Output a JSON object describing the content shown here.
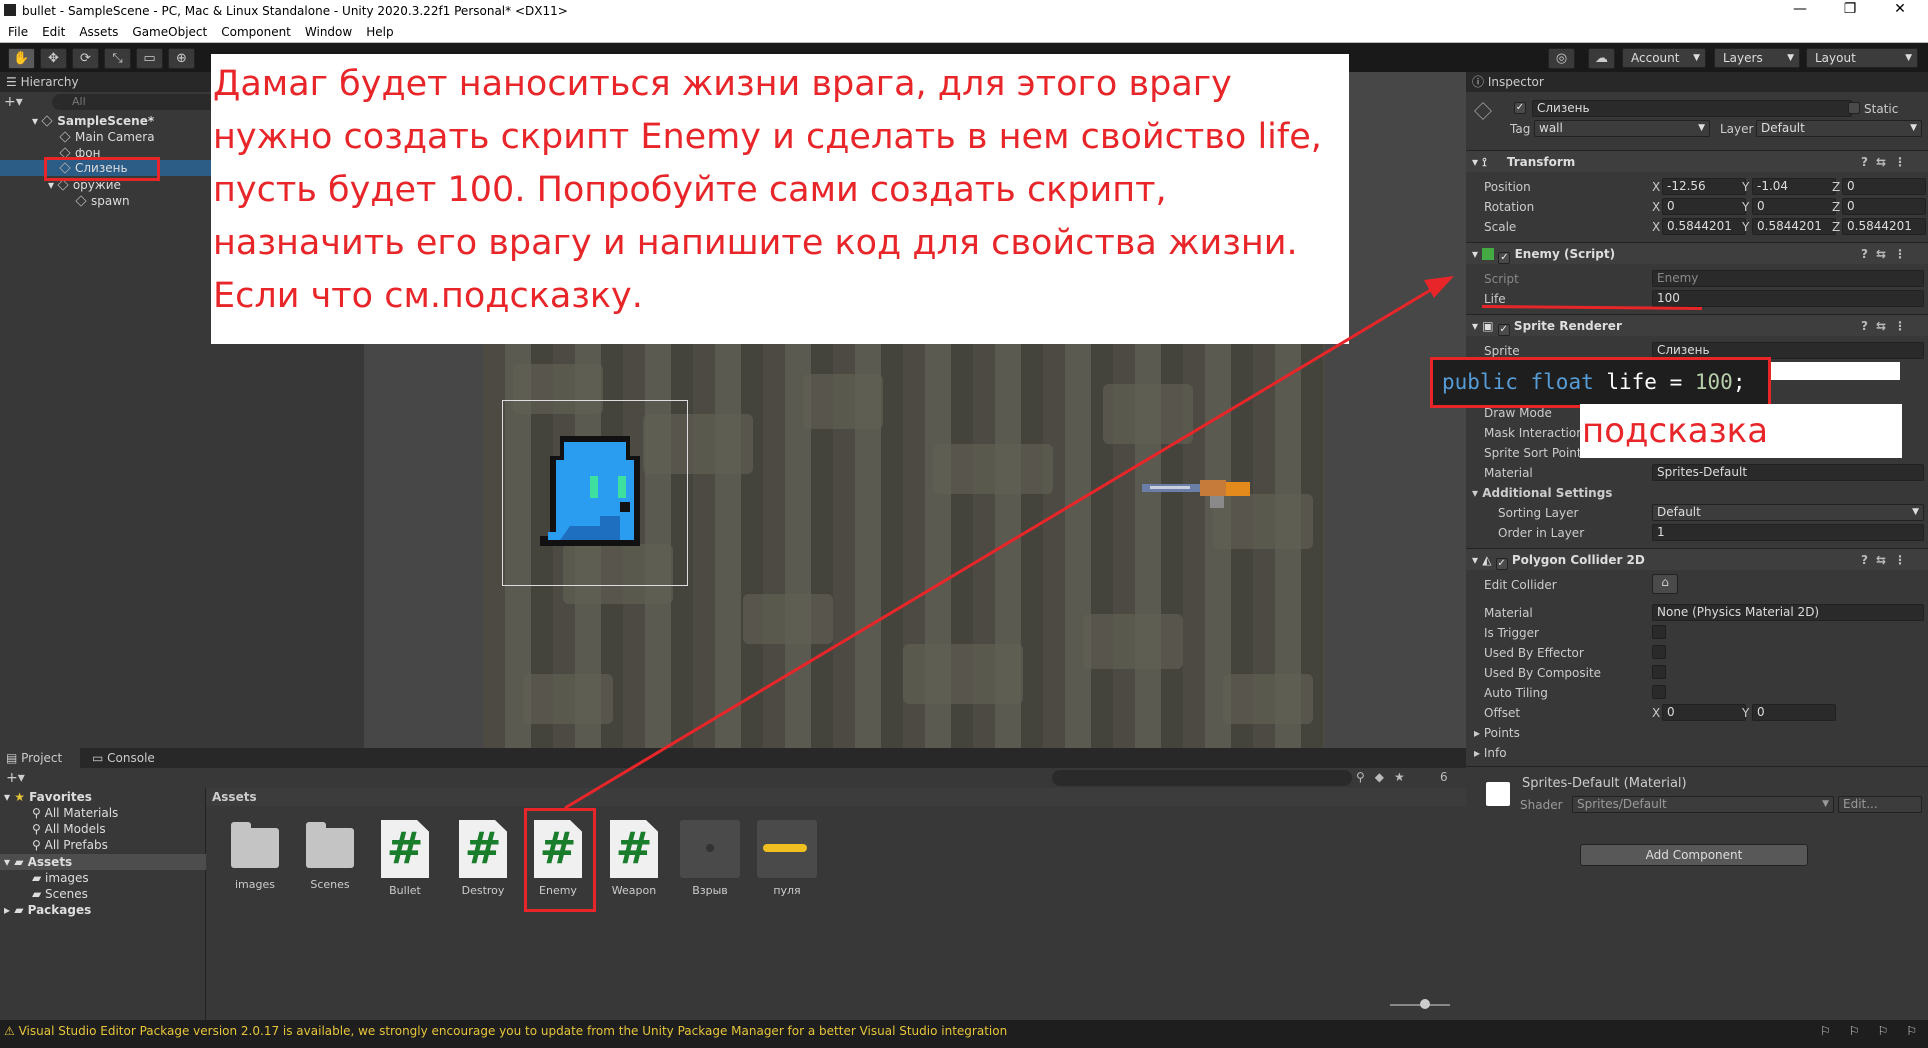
{
  "window": {
    "title": "bullet - SampleScene - PC, Mac & Linux Standalone - Unity 2020.3.22f1 Personal* <DX11>"
  },
  "menu": [
    "File",
    "Edit",
    "Assets",
    "GameObject",
    "Component",
    "Window",
    "Help"
  ],
  "toolbar": {
    "account": "Account",
    "layers": "Layers",
    "layout": "Layout"
  },
  "hierarchy": {
    "title": "Hierarchy",
    "search_placeholder": "All",
    "scene": "SampleScene*",
    "items": [
      "Main Camera",
      "фон",
      "Слизень",
      "оружие",
      "spawn"
    ]
  },
  "overlay_text": "Дамаг будет наноситься жизни врага, для этого врагу нужно создать скрипт Enemy и сделать в нем свойство life, пусть будет 100. Попробуйте сами создать скрипт, назначить его врагу и напишите код для свойства жизни. Если что см.подсказку.",
  "inspector": {
    "title": "Inspector",
    "object_name": "Слизень",
    "static_label": "Static",
    "tag_label": "Tag",
    "tag_value": "wall",
    "layer_label": "Layer",
    "layer_value": "Default",
    "transform": {
      "title": "Transform",
      "position_label": "Position",
      "position": {
        "x": "-12.56",
        "y": "-1.04",
        "z": "0"
      },
      "rotation_label": "Rotation",
      "rotation": {
        "x": "0",
        "y": "0",
        "z": "0"
      },
      "scale_label": "Scale",
      "scale": {
        "x": "0.5844201",
        "y": "0.5844201",
        "z": "0.5844201"
      }
    },
    "enemy_script": {
      "title": "Enemy (Script)",
      "script_label": "Script",
      "script_value": "Enemy",
      "life_label": "Life",
      "life_value": "100"
    },
    "sprite_renderer": {
      "title": "Sprite Renderer",
      "sprite_label": "Sprite",
      "sprite_value": "Слизень",
      "draw_mode_label": "Draw Mode",
      "mask_label": "Mask Interaction",
      "sort_point_label": "Sprite Sort Point",
      "material_label": "Material",
      "material_value": "Sprites-Default",
      "additional_label": "Additional Settings",
      "sorting_layer_label": "Sorting Layer",
      "sorting_layer_value": "Default",
      "order_label": "Order in Layer",
      "order_value": "1"
    },
    "polygon_collider": {
      "title": "Polygon Collider 2D",
      "edit_label": "Edit Collider",
      "material_label": "Material",
      "material_value": "None (Physics Material 2D)",
      "is_trigger": "Is Trigger",
      "used_by_effector": "Used By Effector",
      "used_by_composite": "Used By Composite",
      "auto_tiling": "Auto Tiling",
      "offset_label": "Offset",
      "offset": {
        "x": "0",
        "y": "0"
      },
      "points": "Points",
      "info": "Info"
    },
    "material_section": {
      "name": "Sprites-Default (Material)",
      "shader_label": "Shader",
      "shader_value": "Sprites/Default",
      "edit": "Edit..."
    },
    "add_component": "Add Component"
  },
  "hint": {
    "code_keyword1": "public",
    "code_keyword2": "float",
    "code_rest": " life = ",
    "code_number": "100",
    "code_end": ";",
    "label": "подсказка"
  },
  "project": {
    "tab_project": "Project",
    "tab_console": "Console",
    "favorites": "Favorites",
    "fav_items": [
      "All Materials",
      "All Models",
      "All Prefabs"
    ],
    "assets_label": "Assets",
    "asset_folders": [
      "images",
      "Scenes"
    ],
    "packages": "Packages",
    "breadcrumb": "Assets",
    "count_badge": "6",
    "assets": [
      "images",
      "Scenes",
      "Bullet",
      "Destroy",
      "Enemy",
      "Weapon",
      "Взрыв",
      "пуля"
    ]
  },
  "status": {
    "message": "Visual Studio Editor Package version 2.0.17 is available, we strongly encourage you to update from the Unity Package Manager for a better Visual Studio integration"
  },
  "colors": {
    "annotation_red": "#e8262a",
    "script_green": "#1a7d2c",
    "warning_yellow": "#e6c53a"
  }
}
